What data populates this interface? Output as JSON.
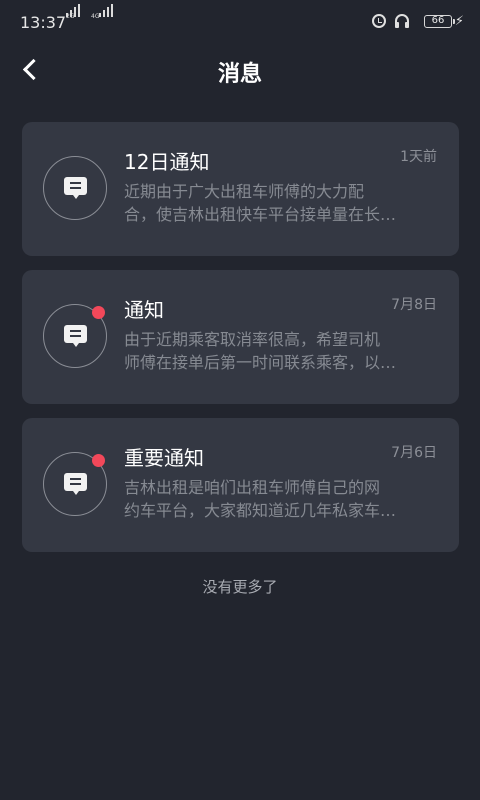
{
  "status_bar": {
    "time": "13:37",
    "signal1_label": "2G",
    "signal2_label": "4G",
    "battery": "66"
  },
  "header": {
    "title": "消息"
  },
  "messages": [
    {
      "title": "12日通知",
      "date": "1天前",
      "preview_line1": "近期由于广大出租车师傅的大力配",
      "preview_line2": "合，使吉林出租快车平台接单量在长…",
      "unread": false
    },
    {
      "title": "通知",
      "date": "7月8日",
      "preview_line1": "由于近期乘客取消率很高，希望司机",
      "preview_line2": "师傅在接单后第一时间联系乘客，以…",
      "unread": true
    },
    {
      "title": "重要通知",
      "date": "7月6日",
      "preview_line1": "吉林出租是咱们出租车师傅自己的网",
      "preview_line2": "约车平台，大家都知道近几年私家车…",
      "unread": true
    }
  ],
  "footer": {
    "end_text": "没有更多了"
  },
  "colors": {
    "background": "#22252e",
    "card": "#343843",
    "unread_dot": "#f2485a"
  }
}
